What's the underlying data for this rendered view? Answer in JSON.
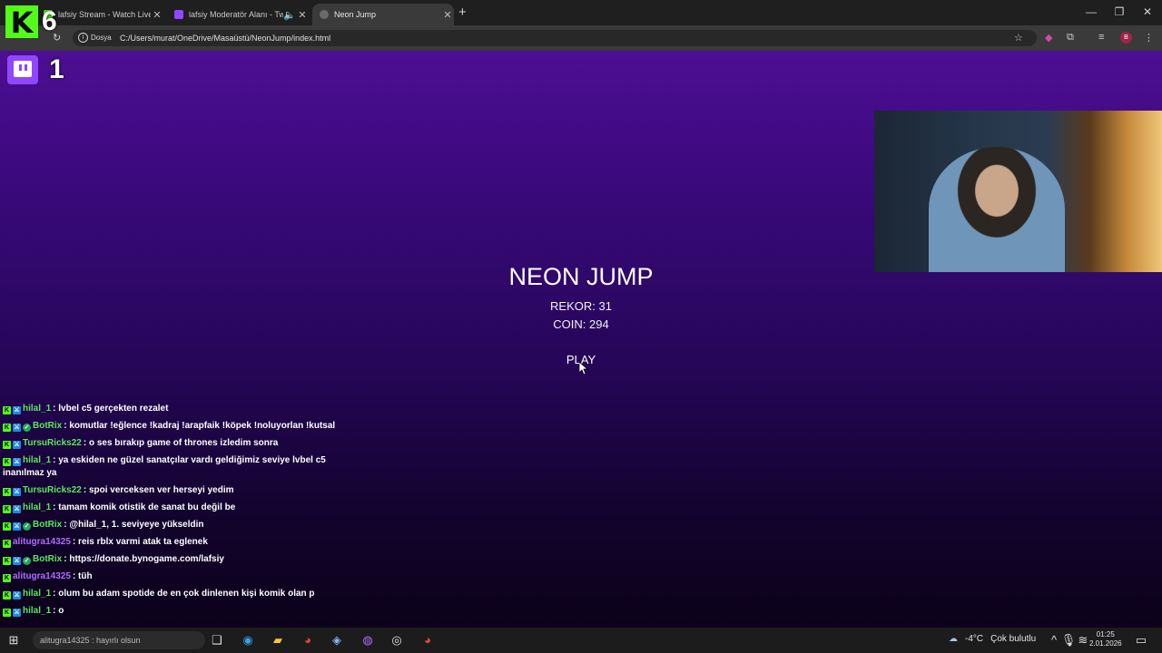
{
  "browser": {
    "tabs": [
      {
        "title": "lafsiy Stream - Watch Live on Ki",
        "active": false
      },
      {
        "title": "lafsiy Moderatör Alanı - Twi",
        "active": false
      },
      {
        "title": "Neon Jump",
        "active": true
      }
    ],
    "new_tab": "+",
    "security_label": "Dosya",
    "url": "C:/Users/murat/OneDrive/Masaüstü/NeonJump/index.html",
    "profile_initial": "B"
  },
  "game": {
    "title": "NEON JUMP",
    "record_label": "REKOR: 31",
    "coin_label": "COIN: 294",
    "play_label": "PLAY"
  },
  "overlay": {
    "kick_viewers": "6",
    "twitch_viewers": "1",
    "kick_color": "#53fc18",
    "twitch_color": "#9146ff"
  },
  "chat": [
    {
      "badges": [
        "kick",
        "mod"
      ],
      "user": "hilal_1",
      "color": "#5ce65c",
      "text": ": lvbel c5 gerçekten rezalet"
    },
    {
      "badges": [
        "kick",
        "mod",
        "bot"
      ],
      "user": "BotRix",
      "color": "#5ce65c",
      "text": ": komutlar !eğlence !kadraj !arapfaik !köpek !noluyorlan !kutsal"
    },
    {
      "badges": [
        "kick",
        "mod"
      ],
      "user": "TursuRicks22",
      "color": "#5ce65c",
      "text": ": o ses bırakıp game of thrones izledim sonra"
    },
    {
      "badges": [
        "kick",
        "mod"
      ],
      "user": "hilal_1",
      "color": "#5ce65c",
      "text": ": ya eskiden ne güzel sanatçılar vardı geldiğimiz seviye lvbel c5 inanılmaz ya"
    },
    {
      "badges": [
        "kick",
        "mod"
      ],
      "user": "TursuRicks22",
      "color": "#5ce65c",
      "text": ": spoi verceksen ver herseyi yedim"
    },
    {
      "badges": [
        "kick",
        "mod"
      ],
      "user": "hilal_1",
      "color": "#5ce65c",
      "text": ": tamam komik otistik de sanat bu değil be"
    },
    {
      "badges": [
        "kick",
        "mod",
        "bot"
      ],
      "user": "BotRix",
      "color": "#5ce65c",
      "text": ": @hilal_1, 1. seviyeye yükseldin"
    },
    {
      "badges": [
        "kick"
      ],
      "user": "alitugra14325",
      "color": "#b06cff",
      "text": ": reis rblx varmi atak ta eglenek"
    },
    {
      "badges": [
        "kick",
        "mod",
        "bot"
      ],
      "user": "BotRix",
      "color": "#5ce65c",
      "text": ": https://donate.bynogame.com/lafsiy"
    },
    {
      "badges": [
        "kick"
      ],
      "user": "alitugra14325",
      "color": "#b06cff",
      "text": ": tüh"
    },
    {
      "badges": [
        "kick",
        "mod"
      ],
      "user": "hilal_1",
      "color": "#5ce65c",
      "text": ": olum bu adam spotide de en çok dinlenen kişi komik olan p"
    },
    {
      "badges": [
        "kick",
        "mod"
      ],
      "user": "hilal_1",
      "color": "#5ce65c",
      "text": ": o"
    }
  ],
  "taskbar": {
    "search_overlay_text": "alitugra14325 : hayırlı olsun",
    "temperature": "-4°C",
    "weather": "Çok bulutlu",
    "time": "01:25",
    "date": "2.01.2026"
  }
}
